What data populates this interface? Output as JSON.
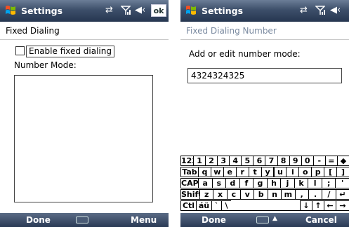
{
  "left": {
    "title": "Settings",
    "ok_label": "ok",
    "subheader": "Fixed Dialing",
    "checkbox_label": "Enable fixed dialing",
    "number_mode_label": "Number Mode:",
    "softkeys": {
      "left": "Done",
      "right": "Menu"
    }
  },
  "right": {
    "title": "Settings",
    "subheader": "Fixed Dialing Number",
    "prompt": "Add or edit number mode:",
    "input_value": "4324324325",
    "softkeys": {
      "left": "Done",
      "right": "Cancel"
    },
    "keyboard": {
      "rows": [
        [
          "123",
          "1",
          "2",
          "3",
          "4",
          "5",
          "6",
          "7",
          "8",
          "9",
          "0",
          "-",
          "=",
          "◆"
        ],
        [
          "Tab",
          "q",
          "w",
          "e",
          "r",
          "t",
          "y",
          "u",
          "i",
          "o",
          "p",
          "[",
          "]"
        ],
        [
          "CAP",
          "a",
          "s",
          "d",
          "f",
          "g",
          "h",
          "j",
          "k",
          "l",
          ";",
          "'"
        ],
        [
          "Shift",
          "z",
          "x",
          "c",
          "v",
          "b",
          "n",
          "m",
          ",",
          ".",
          "/",
          "↵"
        ],
        [
          "Ctl",
          "áü",
          "`",
          "\\",
          " ",
          "↓",
          "↑",
          "←",
          "→"
        ]
      ]
    }
  },
  "icons": {
    "windows": "windows-logo-icon",
    "sync": "sync-arrows-icon",
    "signal": "signal-icon",
    "volume": "volume-icon",
    "keyboard": "keyboard-icon"
  }
}
